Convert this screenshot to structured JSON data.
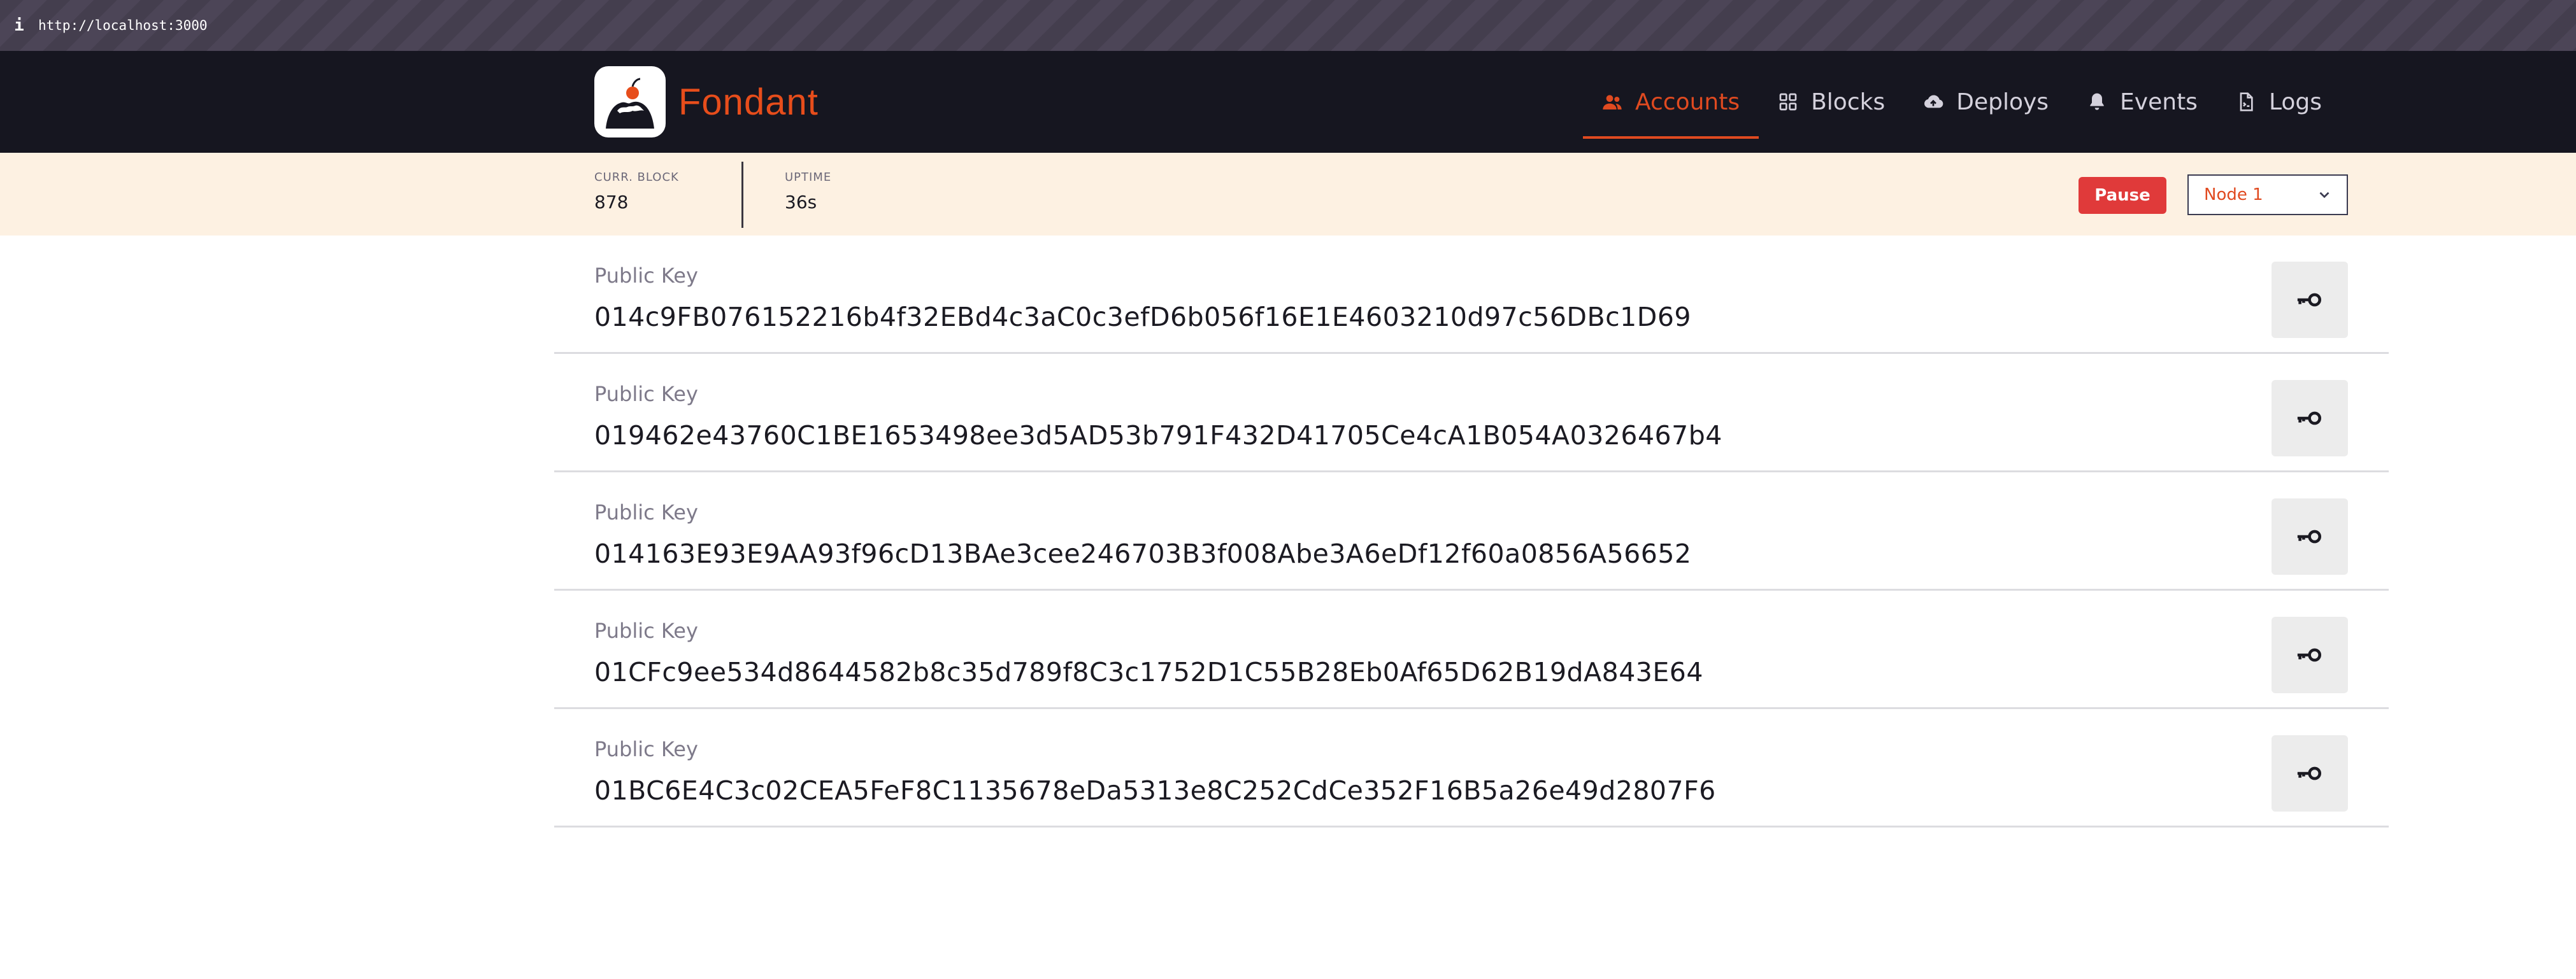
{
  "browser": {
    "url": "http://localhost:3000",
    "info_icon": "i"
  },
  "brand": {
    "name": "Fondant",
    "logo": "fondant-cake-logo"
  },
  "nav": {
    "items": [
      {
        "label": "Accounts",
        "icon": "users-icon",
        "active": true
      },
      {
        "label": "Blocks",
        "icon": "grid-icon",
        "active": false
      },
      {
        "label": "Deploys",
        "icon": "cloud-upload-icon",
        "active": false
      },
      {
        "label": "Events",
        "icon": "bell-icon",
        "active": false
      },
      {
        "label": "Logs",
        "icon": "document-icon",
        "active": false
      }
    ]
  },
  "status": {
    "current_block": {
      "label": "CURR. BLOCK",
      "value": "878"
    },
    "uptime": {
      "label": "UPTIME",
      "value": "36s"
    },
    "pause_label": "Pause",
    "node_selected": "Node 1"
  },
  "accounts": [
    {
      "label": "Public Key",
      "key": "014c9FB076152216b4f32EBd4c3aC0c3efD6b056f16E1E4603210d97c56DBc1D69"
    },
    {
      "label": "Public Key",
      "key": "019462e43760C1BE1653498ee3d5AD53b791F432D41705Ce4cA1B054A0326467b4"
    },
    {
      "label": "Public Key",
      "key": "014163E93E9AA93f96cD13BAe3cee246703B3f008Abe3A6eDf12f60a0856A56652"
    },
    {
      "label": "Public Key",
      "key": "01CFc9ee534d8644582b8c35d789f8C3c1752D1C55B28Eb0Af65D62B19dA843E64"
    },
    {
      "label": "Public Key",
      "key": "01BC6E4C3c02CEA5FeF8C1135678eDa5313e8C252CdCe352F16B5a26e49d2807F6"
    }
  ],
  "colors": {
    "accent": "#e04a20",
    "header_bg": "#161620",
    "status_bg": "#fdf1e2",
    "pause_red": "#e03a3a"
  }
}
